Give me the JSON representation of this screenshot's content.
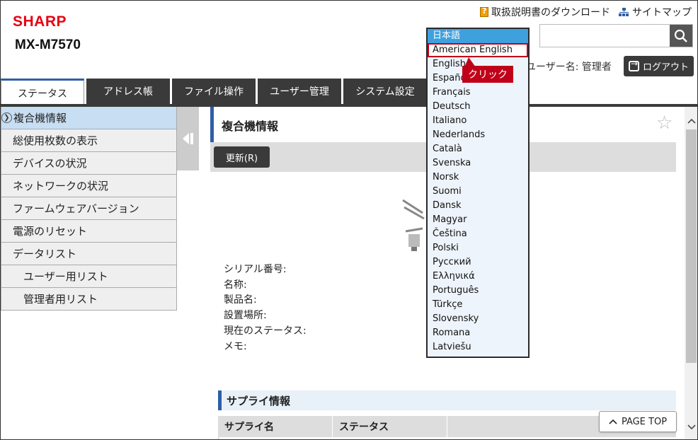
{
  "header": {
    "logo": "SHARP",
    "model": "MX-M7570",
    "links": {
      "manual_download": "取扱説明書のダウンロード",
      "sitemap": "サイトマップ"
    },
    "search": {
      "placeholder": ""
    },
    "user_label": "ユーザー名: 管理者",
    "logout_label": "ログアウト"
  },
  "tabs": [
    {
      "label": "ステータス",
      "active": true
    },
    {
      "label": "アドレス帳"
    },
    {
      "label": "ファイル操作"
    },
    {
      "label": "ユーザー管理"
    },
    {
      "label": "システム設定"
    }
  ],
  "sidebar": {
    "items": [
      {
        "label": "複合機情報",
        "active": true
      },
      {
        "label": "総使用枚数の表示"
      },
      {
        "label": "デバイスの状況"
      },
      {
        "label": "ネットワークの状況"
      },
      {
        "label": "ファームウェアバージョン"
      },
      {
        "label": "電源のリセット"
      },
      {
        "label": "データリスト"
      },
      {
        "label": "ユーザー用リスト"
      },
      {
        "label": "管理者用リスト"
      }
    ]
  },
  "main": {
    "title": "複合機情報",
    "refresh_label": "更新(R)",
    "info_labels": [
      "シリアル番号:",
      "名称:",
      "製品名:",
      "設置場所:",
      "現在のステータス:",
      "メモ:"
    ],
    "supply": {
      "title": "サプライ情報",
      "columns": [
        "サプライ名",
        "ステータス"
      ]
    },
    "pagetop_label": "PAGE TOP"
  },
  "language_dropdown": {
    "selected": "日本語",
    "highlighted": "American English",
    "options": [
      "日本語",
      "American English",
      "English",
      "Español",
      "Français",
      "Deutsch",
      "Italiano",
      "Nederlands",
      "Català",
      "Svenska",
      "Norsk",
      "Suomi",
      "Dansk",
      "Magyar",
      "Čeština",
      "Polski",
      "Русский",
      "Ελληνικά",
      "Português",
      "Türkçe",
      "Slovensky",
      "Romana",
      "Latviešu"
    ]
  },
  "annotation": {
    "callout": "クリック",
    "color": "#c00018"
  },
  "colors": {
    "brand": "#e60012",
    "accent": "#2f5ea8",
    "dark": "#3a3a3a",
    "selected": "#3fa0de"
  }
}
